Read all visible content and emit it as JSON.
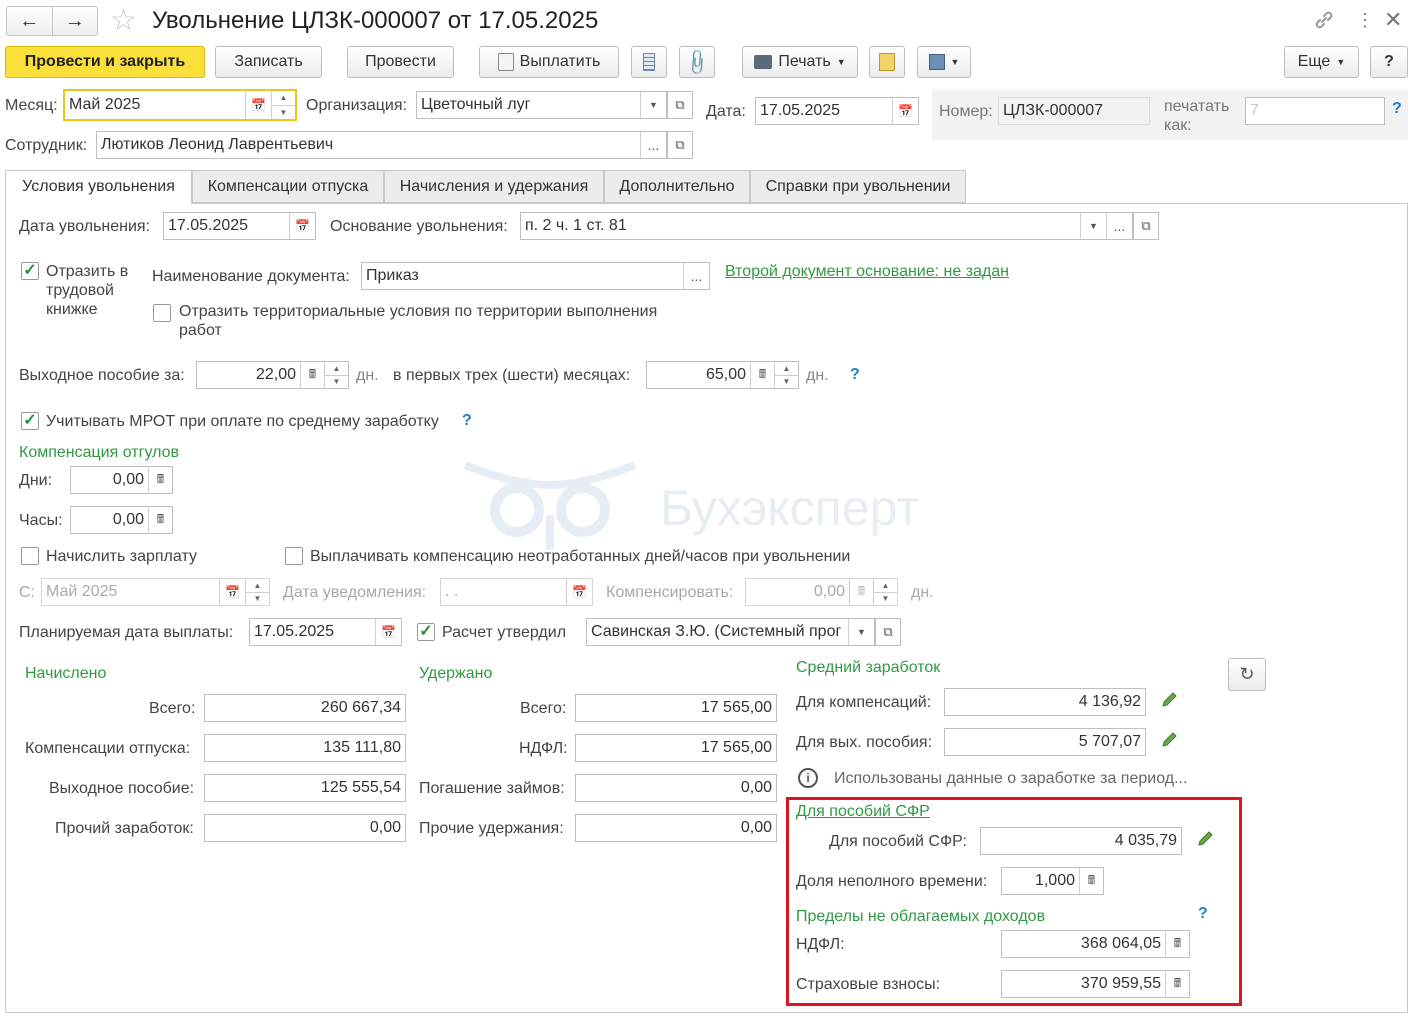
{
  "window": {
    "title": "Увольнение ЦЛЗК-000007 от 17.05.2025"
  },
  "toolbar": {
    "post_close": "Провести и закрыть",
    "save": "Записать",
    "post": "Провести",
    "pay": "Выплатить",
    "print": "Печать",
    "more": "Еще",
    "help": "?"
  },
  "header": {
    "month_label": "Месяц:",
    "month_value": "Май 2025",
    "org_label": "Организация:",
    "org_value": "Цветочный луг",
    "date_label": "Дата:",
    "date_value": "17.05.2025",
    "number_label": "Номер:",
    "number_value": "ЦЛЗК-000007",
    "print_as_label_1": "печатать",
    "print_as_label_2": "как:",
    "print_as_value": "7",
    "employee_label": "Сотрудник:",
    "employee_value": "Лютиков Леонид Лаврентьевич"
  },
  "tabs": [
    {
      "label": "Условия увольнения"
    },
    {
      "label": "Компенсации отпуска"
    },
    {
      "label": "Начисления и удержания"
    },
    {
      "label": "Дополнительно"
    },
    {
      "label": "Справки при увольнении"
    }
  ],
  "conditions": {
    "dismissal_date_label": "Дата увольнения:",
    "dismissal_date_value": "17.05.2025",
    "basis_label": "Основание увольнения:",
    "basis_value": "п. 2 ч. 1 ст. 81",
    "workbook_line1": "Отразить в",
    "workbook_line2": "трудовой",
    "workbook_line3": "книжке",
    "doc_name_label": "Наименование документа:",
    "doc_name_value": "Приказ",
    "second_doc_link": "Второй документ основание: не задан",
    "territorial_line1": "Отразить территориальные условия по территории выполнения",
    "territorial_line2": "работ",
    "severance_label": "Выходное пособие за:",
    "severance_value": "22,00",
    "days_unit": "дн.",
    "first_months_label": "в первых трех (шести) месяцах:",
    "first_months_value": "65,00",
    "mrot_label": "Учитывать МРОТ при оплате по среднему заработку",
    "time_off_header": "Компенсация отгулов",
    "days_label": "Дни:",
    "days_value": "0,00",
    "hours_label": "Часы:",
    "hours_value": "0,00",
    "accrue_salary_label": "Начислить зарплату",
    "pay_comp_label": "Выплачивать компенсацию неотработанных дней/часов при увольнении",
    "from_label": "С:",
    "from_value": "Май 2025",
    "notice_date_label": "Дата уведомления:",
    "notice_date_value": " .  .",
    "compensate_label": "Компенсировать:",
    "compensate_value": "0,00",
    "planned_date_label": "Планируемая дата выплаты:",
    "planned_date_value": "17.05.2025",
    "approved_label": "Расчет утвердил",
    "approved_value": "Савинская З.Ю. (Системный прог"
  },
  "accrued": {
    "header": "Начислено",
    "total_label": "Всего:",
    "total_value": "260 667,34",
    "vacation_label": "Компенсации отпуска:",
    "vacation_value": "135 111,80",
    "severance_label": "Выходное пособие:",
    "severance_value": "125 555,54",
    "other_label": "Прочий заработок:",
    "other_value": "0,00"
  },
  "withheld": {
    "header": "Удержано",
    "total_label": "Всего:",
    "total_value": "17 565,00",
    "ndfl_label": "НДФЛ:",
    "ndfl_value": "17 565,00",
    "loans_label": "Погашение займов:",
    "loans_value": "0,00",
    "other_label": "Прочие удержания:",
    "other_value": "0,00"
  },
  "average": {
    "header": "Средний заработок",
    "comp_label": "Для компенсаций:",
    "comp_value": "4 136,92",
    "sev_label": "Для вых. пособия:",
    "sev_value": "5 707,07",
    "info_text": "Использованы данные о заработке за период...",
    "sfr_link": "Для пособий СФР",
    "sfr_label": "Для пособий СФР:",
    "sfr_value": "4 035,79",
    "part_time_label": "Доля неполного времени:",
    "part_time_value": "1,000",
    "limits_header": "Пределы не облагаемых доходов",
    "ndfl_label": "НДФЛ:",
    "ndfl_value": "368 064,05",
    "insurance_label": "Страховые взносы:",
    "insurance_value": "370 959,55"
  },
  "watermark": "Бухэксперт",
  "colors": {
    "accent_green": "#2f9a42",
    "primary_button": "#fbe03b",
    "highlight_box": "#e0141f",
    "help_blue": "#1e7fd0"
  }
}
